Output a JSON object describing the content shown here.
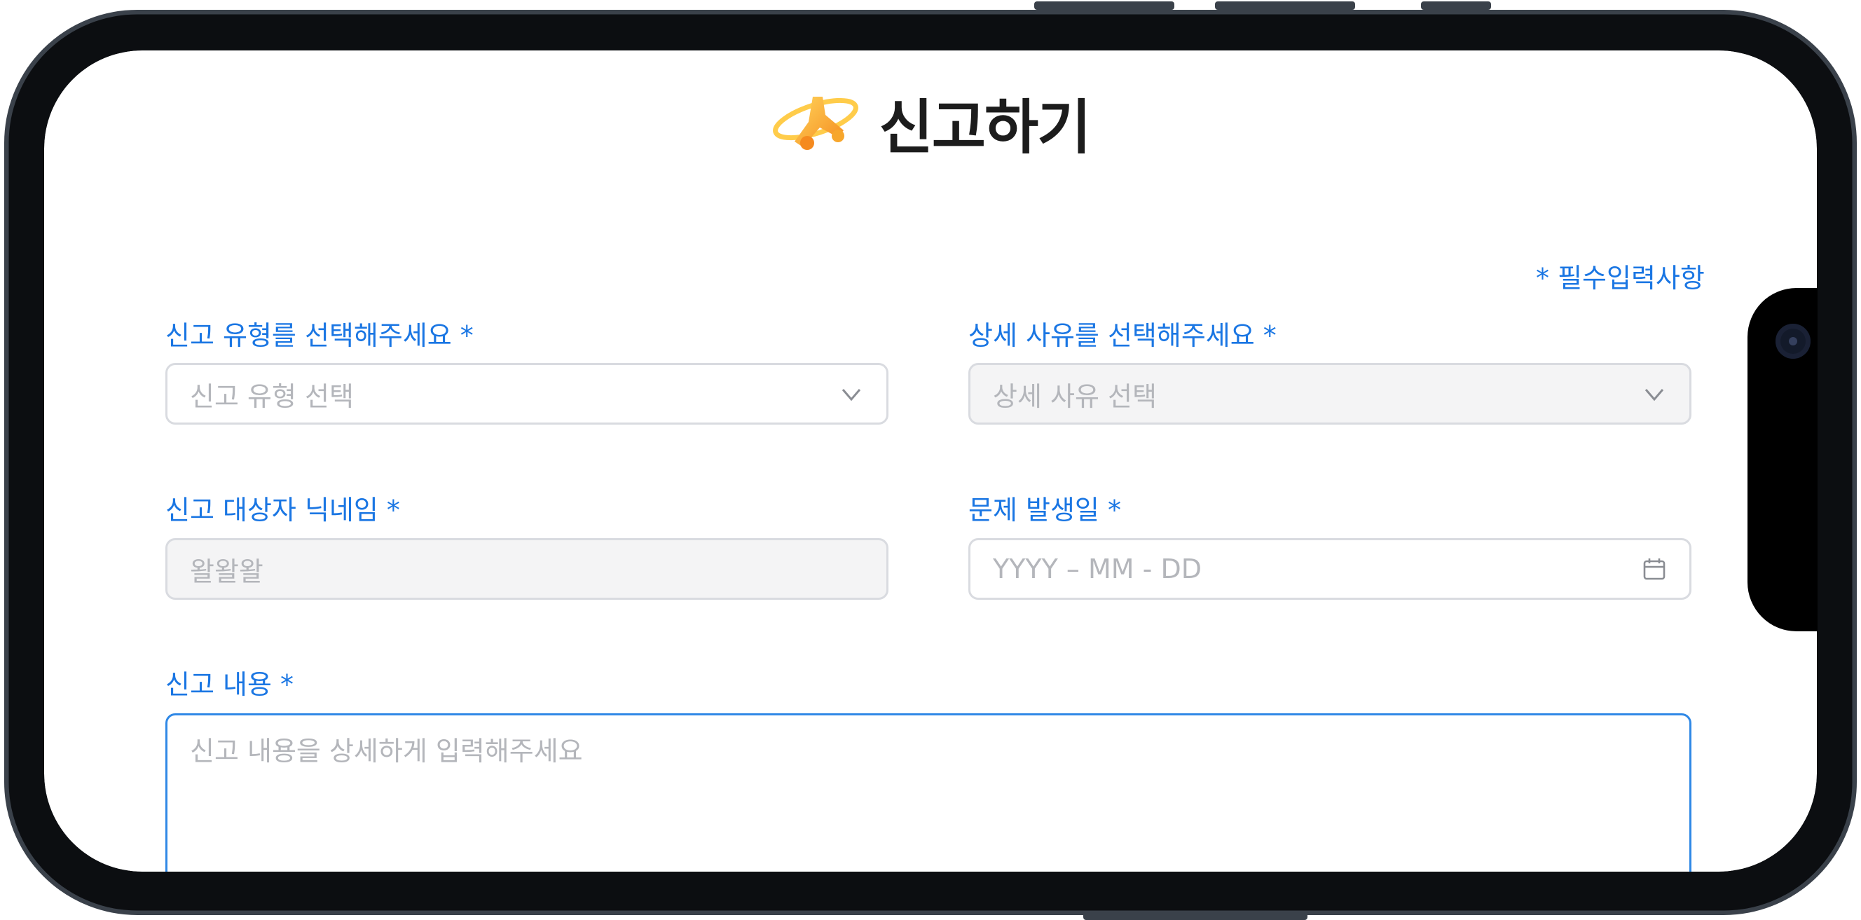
{
  "header": {
    "title": "신고하기",
    "logo_icon": "orbit-star-logo-icon"
  },
  "form": {
    "required_note": "* 필수입력사항",
    "report_type": {
      "label": "신고 유형를 선택해주세요 *",
      "placeholder": "신고 유형 선택",
      "icon": "chevron-down-icon"
    },
    "detail_reason": {
      "label": "상세 사유를 선택해주세요 *",
      "placeholder": "상세 사유 선택",
      "icon": "chevron-down-icon"
    },
    "target_nickname": {
      "label": "신고 대상자 닉네임 *",
      "value": "왈왈왈"
    },
    "incident_date": {
      "label": "문제 발생일 *",
      "placeholder": "YYYY – MM - DD",
      "icon": "calendar-icon"
    },
    "report_content": {
      "label": "신고 내용 *",
      "placeholder": "신고 내용을 상세하게 입력해주세요"
    }
  },
  "colors": {
    "accent": "#1a76e3",
    "placeholder": "#b4b6bb",
    "border": "#d9dbe0",
    "disabled_bg": "#f4f4f5",
    "logo_orange": "#f5a623"
  }
}
